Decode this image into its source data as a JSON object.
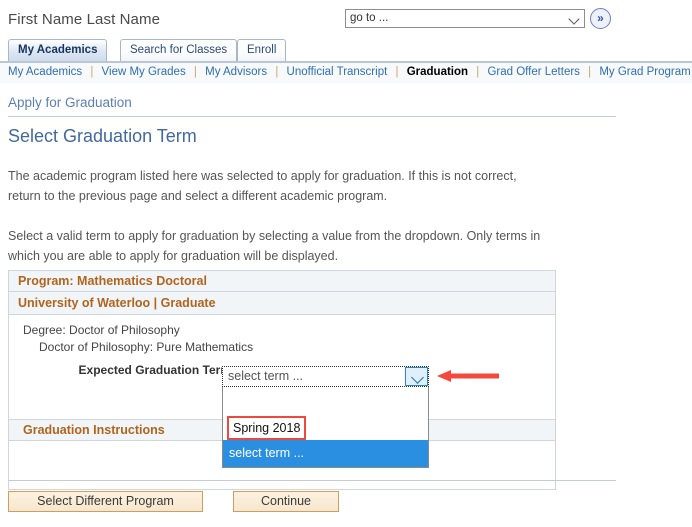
{
  "header": {
    "user_name": "First Name Last Name",
    "goto": {
      "value": "go to ...",
      "underline_char": "g",
      "caret_icon": "chevron-down-icon",
      "go_button_label": "»"
    }
  },
  "tabs": [
    {
      "label": "My Academics",
      "accesskey": "",
      "active": true
    },
    {
      "label": "Search for Classes",
      "accesskey": "e",
      "active": false
    },
    {
      "label": "Enroll",
      "accesskey": "E",
      "active": false
    }
  ],
  "subnav": {
    "items": [
      {
        "label": "My Academics",
        "accesskey": "My",
        "current": false
      },
      {
        "label": "View My Grades",
        "accesskey": "",
        "current": false
      },
      {
        "label": "My Advisors",
        "accesskey": "My",
        "current": false
      },
      {
        "label": "Unofficial Transcript",
        "accesskey": "",
        "current": false
      },
      {
        "label": "Graduation",
        "accesskey": "",
        "current": true
      },
      {
        "label": "Grad Offer Letters",
        "accesskey": "",
        "current": false
      },
      {
        "label": "My Grad Program",
        "accesskey": "",
        "current": false
      }
    ],
    "separator": "|"
  },
  "breadcrumb": "Apply for Graduation",
  "page_title": "Select Graduation Term",
  "paragraphs": {
    "p1": "The academic program listed here was selected to apply for graduation. If this is not correct, return to the previous page and select a different academic program.",
    "p2": "Select a valid term to apply for graduation by selecting a value from the dropdown. Only terms in which you are able to apply for graduation will be displayed."
  },
  "program_panel": {
    "program_header": "Program: Mathematics Doctoral",
    "institution_header": "University of Waterloo | Graduate",
    "degree_line_1": "Degree: Doctor of Philosophy",
    "degree_line_2": "Doctor of Philosophy: Pure Mathematics",
    "term_label": "Expected Graduation Term",
    "graduation_instructions_header": "Graduation Instructions"
  },
  "term_dropdown": {
    "selected_value": "select term ...",
    "expanded": true,
    "options": [
      {
        "label": "",
        "blank": true,
        "highlighted": false,
        "selected": false
      },
      {
        "label": "Spring 2018",
        "blank": false,
        "highlighted": true,
        "selected": false
      },
      {
        "label": "select term ...",
        "blank": false,
        "highlighted": false,
        "selected": true
      }
    ],
    "toggle_icon": "chevron-down-icon"
  },
  "annotation": {
    "arrow_icon": "left-arrow-annotation",
    "arrow_color": "#f0483c",
    "highlight_box_color": "#f0483c"
  },
  "footer": {
    "select_different_program_label": "Select Different Program",
    "continue_label": "Continue"
  },
  "colors": {
    "section_header_text": "#b0641e",
    "title_blue": "#41699f",
    "link_blue": "#2f6fb5",
    "selected_option_bg": "#2a8fe0",
    "button_bg": "#f7e6cd"
  }
}
